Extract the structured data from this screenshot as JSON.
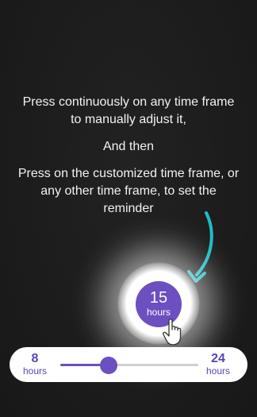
{
  "tutorial": {
    "line1": "Press continuously on any time frame to manually adjust it,",
    "line2": "And then",
    "line3": "Press on the customized time frame, or any other time frame, to set the reminder"
  },
  "highlight": {
    "value": "15",
    "unit": "hours"
  },
  "slider": {
    "min_value": "8",
    "min_unit": "hours",
    "max_value": "24",
    "max_unit": "hours",
    "position_fraction": 0.35
  },
  "colors": {
    "accent": "#6c4fc0",
    "arrow": "#1fbcc4",
    "background": "#1c1c1c"
  },
  "icons": {
    "pointer": "hand-pointer-icon",
    "arrow": "curved-arrow-icon"
  }
}
